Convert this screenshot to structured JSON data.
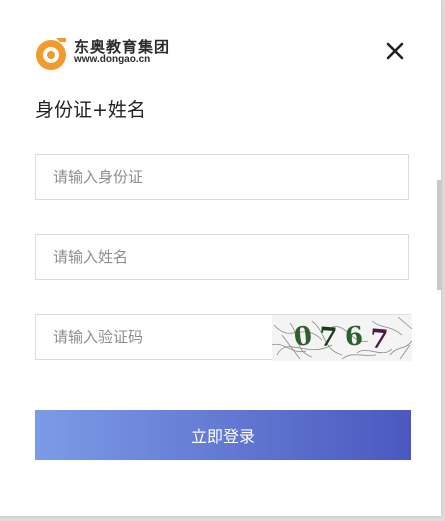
{
  "logo": {
    "name_cn": "东奥教育集团",
    "url": "www.dongao.cn"
  },
  "title": "身份证+姓名",
  "fields": {
    "id_card": {
      "placeholder": "请输入身份证",
      "value": ""
    },
    "name": {
      "placeholder": "请输入姓名",
      "value": ""
    },
    "captcha": {
      "placeholder": "请输入验证码",
      "value": ""
    }
  },
  "captcha_code": [
    "0",
    "7",
    "6",
    "7"
  ],
  "login_button": "立即登录",
  "colors": {
    "logo_orange": "#f39a2c",
    "button_start": "#7c9be6",
    "button_end": "#4a58bf",
    "captcha_green": "#2f5f2f",
    "captcha_purple": "#4a1a44"
  },
  "icons": {
    "close": "close-icon",
    "logo": "dongao-logo-icon"
  }
}
